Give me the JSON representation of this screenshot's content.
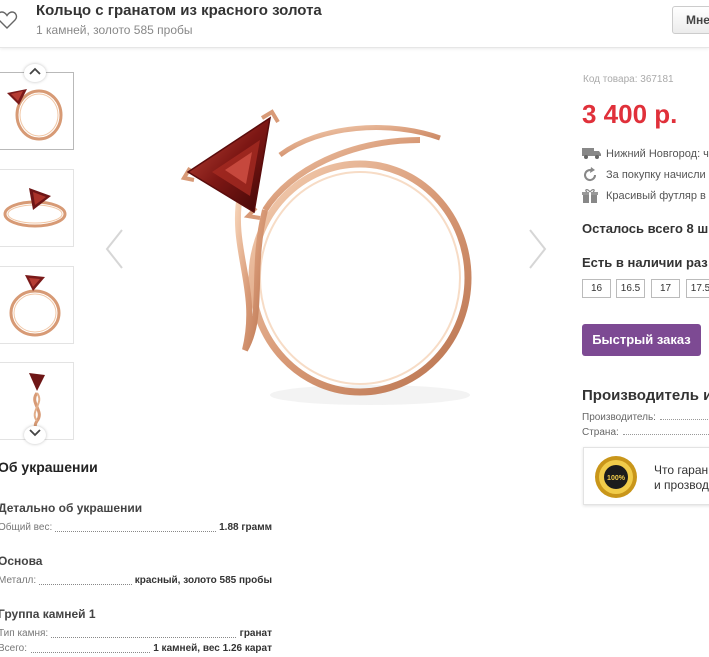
{
  "header": {
    "title": "Кольцо с гранатом из красного золота",
    "subtitle": "1 камней, золото 585 пробы",
    "compare_button_label": "Мне"
  },
  "gallery": {
    "thumbnails": [
      "ring-angled-view",
      "ring-side-view",
      "ring-front-view",
      "ring-edge-view"
    ],
    "up_icon": "chevron-up-icon",
    "down_icon": "chevron-down-icon",
    "prev_icon": "chevron-left-icon",
    "next_icon": "chevron-right-icon"
  },
  "product": {
    "sku_text": "Код товара: 367181",
    "price": "3 400 р.",
    "price_color": "#e0303a",
    "info": [
      {
        "icon": "truck-icon",
        "text": "Нижний Новгород: ч"
      },
      {
        "icon": "refresh-icon",
        "text": "За покупку начисли"
      },
      {
        "icon": "gift-icon",
        "text": "Красивый футляр в"
      }
    ],
    "stock_note": "Осталось всего 8 ш",
    "sizes_heading": "Есть в наличии раз",
    "sizes": [
      "16",
      "16.5",
      "17",
      "17.5"
    ],
    "quick_order_label": "Быстрый заказ",
    "accent_color": "#7d4a93"
  },
  "manufacturer": {
    "heading": "Производитель и",
    "rows": [
      {
        "label": "Производитель:"
      },
      {
        "label": "Страна:"
      }
    ],
    "guarantee_seal_text": "100%",
    "guarantee_line1": "Что гаран",
    "guarantee_line2": "и прозвод"
  },
  "details": {
    "heading": "Об украшении",
    "groups": [
      {
        "title": "Детально об украшении",
        "props": [
          {
            "key": "Общий вес:",
            "value": "1.88 грамм"
          }
        ]
      },
      {
        "title": "Основа",
        "props": [
          {
            "key": "Металл:",
            "value": "красный, золото 585 пробы"
          }
        ]
      },
      {
        "title": "Группа камней 1",
        "props": [
          {
            "key": "Тип камня:",
            "value": "гранат"
          },
          {
            "key": "Всего:",
            "value": "1 камней, вес 1.26 карат"
          }
        ]
      }
    ]
  }
}
